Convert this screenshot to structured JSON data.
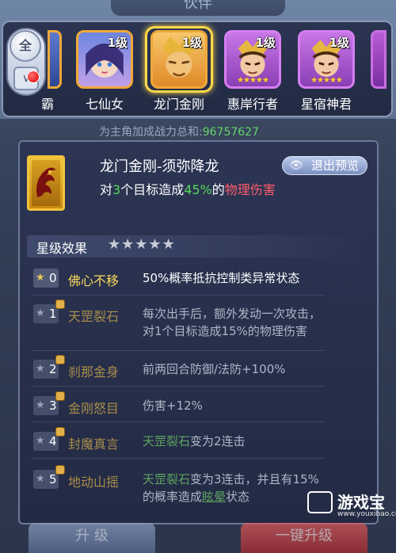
{
  "header": {
    "title": "伙伴"
  },
  "filter": {
    "all_label": "全",
    "dropdown_icon": "chevron-down-icon"
  },
  "heroes": [
    {
      "name": "霸",
      "level": "",
      "stars": ""
    },
    {
      "name": "七仙女",
      "level": "1级",
      "stars": ""
    },
    {
      "name": "龙门金刚",
      "level": "1级",
      "stars": ""
    },
    {
      "name": "惠岸行者",
      "level": "1级",
      "stars": "★★★★★"
    },
    {
      "name": "星宿神君",
      "level": "1级",
      "stars": "★★★★★"
    }
  ],
  "power": {
    "label": "为主角加成战力总和:",
    "value": "96757627"
  },
  "skill": {
    "title": "龙门金刚-须弥降龙",
    "desc_prefix": "对",
    "desc_targets": "3",
    "desc_mid": "个目标造成",
    "desc_percent": "45%",
    "desc_mid2": "的",
    "desc_type": "物理伤害",
    "exit_label": "退出预览"
  },
  "star_effects": {
    "label": "星级效果",
    "stars": "★★★★★",
    "rows": [
      {
        "level": "0",
        "name": "佛心不移",
        "line1": "50%概率抵抗控制类异常状态",
        "line2": ""
      },
      {
        "level": "1",
        "name": "天罡裂石",
        "line1": "每次出手后，额外发动一次攻击，",
        "line2": "对1个目标造成15%的物理伤害"
      },
      {
        "level": "2",
        "name": "刹那金身",
        "line1": "前两回合防御/法防+100%",
        "line2": ""
      },
      {
        "level": "3",
        "name": "金刚怒目",
        "line1": "伤害+12%",
        "line2": ""
      },
      {
        "level": "4",
        "name": "封魔真言",
        "line1_hl": "天罡裂石",
        "line1": "变为2连击",
        "line2": ""
      },
      {
        "level": "5",
        "name": "地动山摇",
        "line1_hl": "天罡裂石",
        "line1": "变为3连击，并且有15%",
        "line2_pre": "的概率造成",
        "line2_hl": "眩晕",
        "line2": "状态"
      }
    ]
  },
  "buttons": {
    "upgrade": "升 级",
    "one_click_upgrade": "一键升级"
  },
  "watermark": {
    "name": "游戏宝",
    "url": "www.youxibao.com"
  },
  "colors": {
    "green": "#56d95b",
    "red": "#ff5c6c",
    "gold": "#f7d75a",
    "frame": "#ffd84a"
  }
}
